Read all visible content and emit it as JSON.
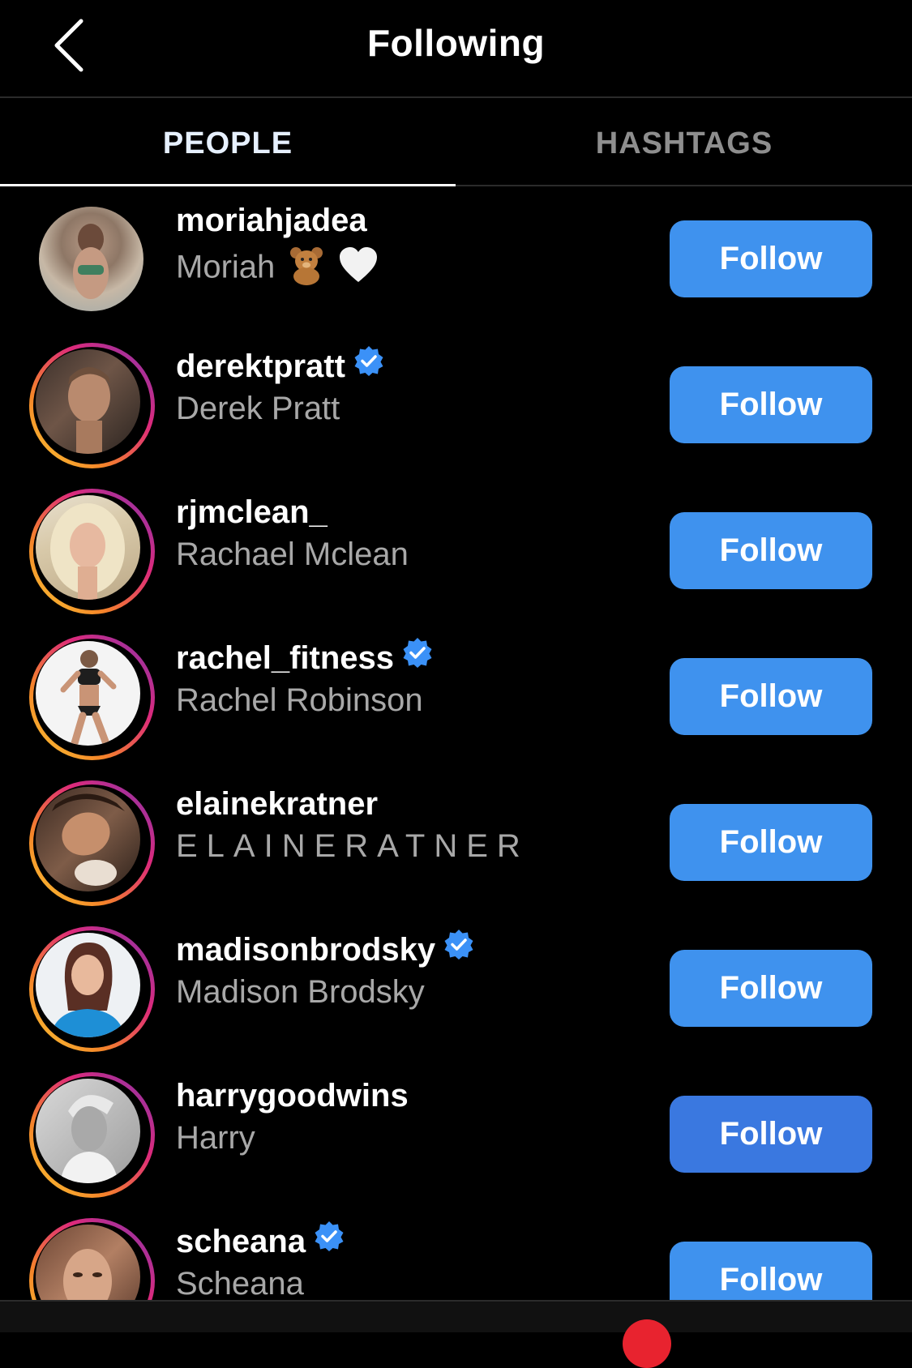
{
  "header": {
    "title": "Following",
    "back_icon": "chevron-left-icon"
  },
  "tabs": [
    {
      "label": "PEOPLE",
      "active": true
    },
    {
      "label": "HASHTAGS",
      "active": false
    }
  ],
  "colors": {
    "follow_button": "#3f92ee",
    "verified": "#3b91f7",
    "story_ring_start": "#f9ce34",
    "story_ring_end": "#8134af",
    "secondary_text": "#a8a8a8",
    "notification_dot": "#e8232f"
  },
  "users": [
    {
      "username": "moriahjadea",
      "full_name": "Moriah",
      "name_emojis": [
        "teddy-bear-icon",
        "white-heart-icon"
      ],
      "verified": false,
      "story_ring": false,
      "button": "Follow"
    },
    {
      "username": "derektpratt",
      "full_name": "Derek Pratt",
      "verified": true,
      "story_ring": true,
      "button": "Follow"
    },
    {
      "username": "rjmclean_",
      "full_name": "Rachael Mclean",
      "verified": false,
      "story_ring": true,
      "button": "Follow"
    },
    {
      "username": "rachel_fitness",
      "full_name": "Rachel Robinson",
      "verified": true,
      "story_ring": true,
      "button": "Follow"
    },
    {
      "username": "elainekratner",
      "full_name": "ELAINERATNER",
      "verified": false,
      "story_ring": true,
      "button": "Follow"
    },
    {
      "username": "madisonbrodsky",
      "full_name": "Madison Brodsky",
      "verified": true,
      "story_ring": true,
      "button": "Follow"
    },
    {
      "username": "harrygoodwins",
      "full_name": "Harry",
      "verified": false,
      "story_ring": true,
      "button": "Follow"
    },
    {
      "username": "scheana",
      "full_name": "Scheana",
      "verified": true,
      "story_ring": true,
      "button": "Follow"
    }
  ]
}
